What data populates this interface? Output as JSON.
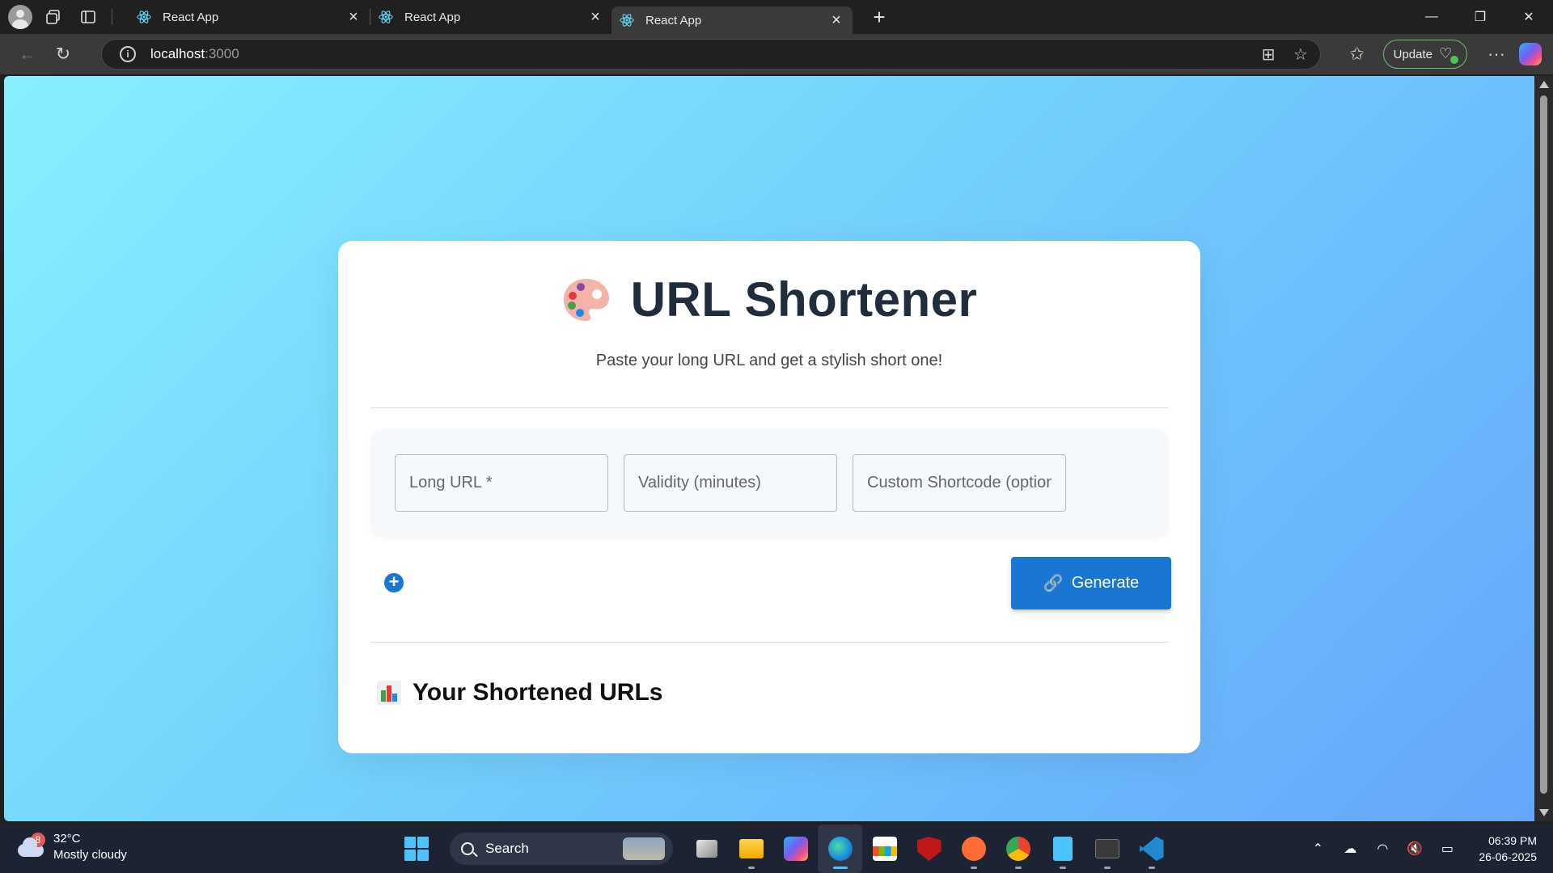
{
  "browser": {
    "tabs": [
      {
        "title": "React App"
      },
      {
        "title": "React App"
      },
      {
        "title": "React App"
      }
    ],
    "address": {
      "host": "localhost",
      "port": ":3000"
    },
    "update_label": "Update"
  },
  "app": {
    "title": "URL Shortener",
    "subtitle": "Paste your long URL and get a stylish short one!",
    "fields": {
      "long_url_placeholder": "Long URL *",
      "validity_placeholder": "Validity (minutes)",
      "shortcode_placeholder": "Custom Shortcode (optional)"
    },
    "add_label": "+",
    "generate_label": "Generate",
    "section_title": "Your Shortened URLs",
    "accent_color": "#1976d2"
  },
  "taskbar": {
    "weather": {
      "temp": "32°C",
      "condition": "Mostly cloudy",
      "badge": "8"
    },
    "search_label": "Search",
    "clock": {
      "time": "06:39 PM",
      "date": "26-06-2025"
    }
  }
}
